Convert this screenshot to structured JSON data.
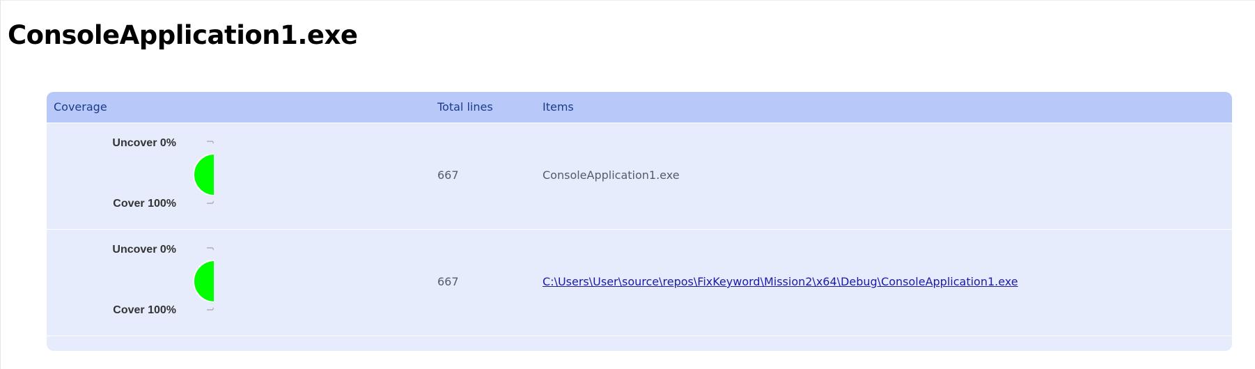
{
  "page": {
    "title": "ConsoleApplication1.exe"
  },
  "table": {
    "headers": {
      "coverage": "Coverage",
      "total_lines": "Total lines",
      "items": "Items"
    },
    "rows": [
      {
        "uncover_label": "Uncover 0%",
        "cover_label": "Cover 100%",
        "cover_fraction": 1.0,
        "total_lines": "667",
        "item": "ConsoleApplication1.exe",
        "item_is_link": false
      },
      {
        "uncover_label": "Uncover 0%",
        "cover_label": "Cover 100%",
        "cover_fraction": 1.0,
        "total_lines": "667",
        "item": "C:\\Users\\User\\source\\repos\\FixKeyword\\Mission2\\x64\\Debug\\ConsoleApplication1.exe",
        "item_is_link": true
      }
    ]
  },
  "colors": {
    "pie_cover": "#00ff00",
    "header_bg": "#b8c9f9",
    "header_text": "#1b3b8c",
    "row_bg": "#e6ecfc",
    "link": "#1a1aa6"
  },
  "icons": {
    "pie": "coverage-pie-chart"
  }
}
